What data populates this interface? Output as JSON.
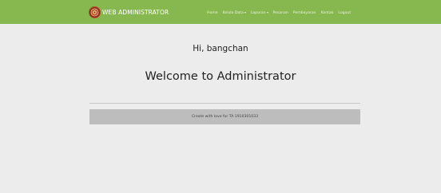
{
  "navbar": {
    "brand": "WEB ADMINISTRATOR",
    "logo_icon": "emblem-icon",
    "bg_color": "#87b84f",
    "items": [
      {
        "label": "Home",
        "dropdown": false
      },
      {
        "label": "Kelola Data",
        "dropdown": true
      },
      {
        "label": "Laporan",
        "dropdown": true
      },
      {
        "label": "Pesanan",
        "dropdown": false
      },
      {
        "label": "Pembayaran",
        "dropdown": false
      },
      {
        "label": "Kontak",
        "dropdown": false
      },
      {
        "label": "Logout",
        "dropdown": false
      }
    ]
  },
  "main": {
    "greeting": "Hi, bangchan",
    "welcome": "Welcome to Administrator"
  },
  "footer": {
    "text": "Create with love for TA 1910301033"
  }
}
